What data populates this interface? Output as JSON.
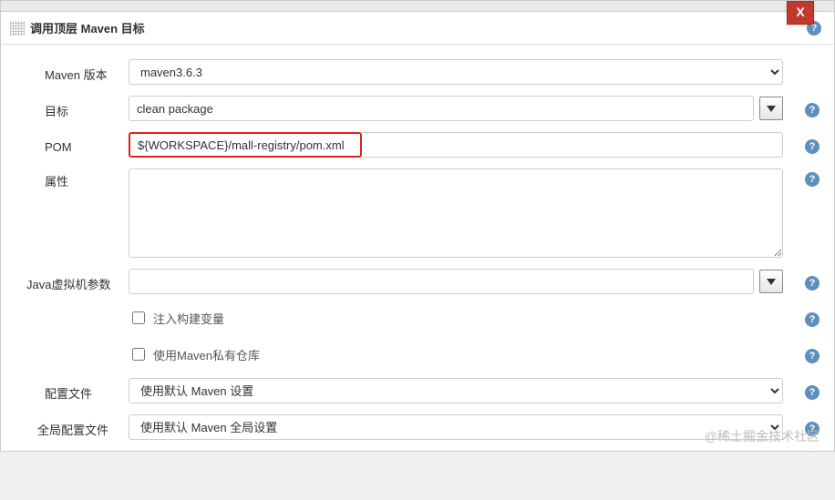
{
  "panel": {
    "title": "调用顶层 Maven 目标",
    "close_label": "X"
  },
  "fields": {
    "maven_version": {
      "label": "Maven 版本",
      "value": "maven3.6.3"
    },
    "goal": {
      "label": "目标",
      "value": "clean package"
    },
    "pom": {
      "label": "POM",
      "value": "${WORKSPACE}/mall-registry/pom.xml"
    },
    "properties": {
      "label": "属性",
      "value": ""
    },
    "jvm_args": {
      "label": "Java虚拟机参数",
      "value": ""
    },
    "inject_build_vars": {
      "label": "注入构建变量",
      "checked": false
    },
    "use_private_repo": {
      "label": "使用Maven私有仓库",
      "checked": false
    },
    "config_file": {
      "label": "配置文件",
      "value": "使用默认 Maven 设置"
    },
    "global_config_file": {
      "label": "全局配置文件",
      "value": "使用默认 Maven 全局设置"
    }
  },
  "watermark": "@稀土掘金技术社区",
  "icons": {
    "help_glyph": "?"
  }
}
